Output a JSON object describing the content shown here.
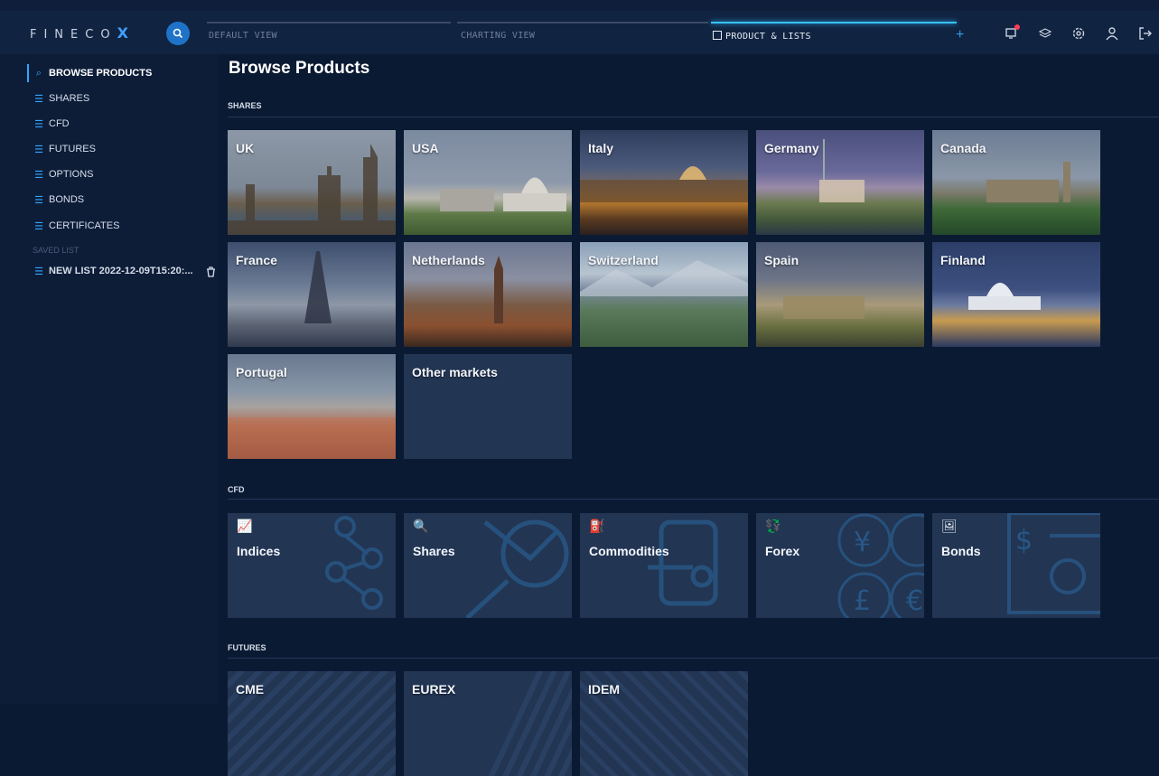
{
  "app": {
    "logo": "FINECO",
    "logo_x": "X"
  },
  "tabs": [
    {
      "label": "DEFAULT VIEW"
    },
    {
      "label": "CHARTING VIEW"
    },
    {
      "label": "PRODUCT & LISTS"
    }
  ],
  "top_icons": [
    "notification-icon",
    "layers-icon",
    "settings-icon",
    "user-icon",
    "logout-icon"
  ],
  "sidebar": {
    "items": [
      {
        "label": "BROWSE PRODUCTS"
      },
      {
        "label": "SHARES"
      },
      {
        "label": "CFD"
      },
      {
        "label": "FUTURES"
      },
      {
        "label": "OPTIONS"
      },
      {
        "label": "BONDS"
      },
      {
        "label": "CERTIFICATES"
      }
    ],
    "saved_title": "SAVED LIST",
    "saved_lists": [
      {
        "label": "NEW LIST 2022-12-09T15:20:..."
      }
    ]
  },
  "main": {
    "title": "Browse Products",
    "sections": {
      "shares": {
        "title": "SHARES",
        "cards": [
          "UK",
          "USA",
          "Italy",
          "Germany",
          "Canada",
          "France",
          "Netherlands",
          "Switzerland",
          "Spain",
          "Finland",
          "Portugal",
          "Other markets"
        ]
      },
      "cfd": {
        "title": "CFD",
        "cards": [
          "Indices",
          "Shares",
          "Commodities",
          "Forex",
          "Bonds"
        ]
      },
      "futures": {
        "title": "FUTURES",
        "cards": [
          "CME",
          "EUREX",
          "IDEM"
        ]
      }
    }
  },
  "colors": {
    "background": "#0b1a33",
    "accent": "#33a6ff",
    "card": "#223553"
  }
}
